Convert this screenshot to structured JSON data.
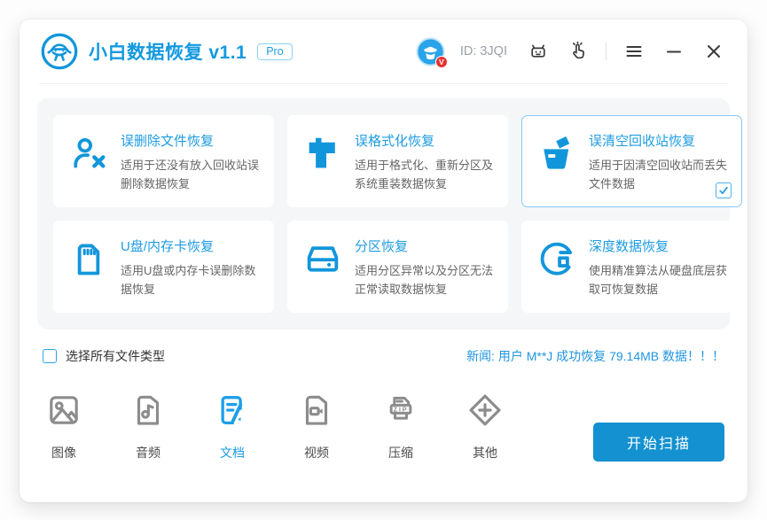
{
  "header": {
    "app_title": "小白数据恢复 v1.1",
    "pro_badge": "Pro",
    "user_id": "ID: 3JQI",
    "avatar_badge": "V"
  },
  "cards": [
    {
      "icon": "user-x-icon",
      "title": "误删除文件恢复",
      "desc": "适用于还没有放入回收站误删除数据恢复",
      "selected": false
    },
    {
      "icon": "format-brush-icon",
      "title": "误格式化恢复",
      "desc": "适用于格式化、重新分区及系统重装数据恢复",
      "selected": false
    },
    {
      "icon": "recycle-bin-icon",
      "title": "误清空回收站恢复",
      "desc": "适用于因清空回收站而丢失文件数据",
      "selected": true
    },
    {
      "icon": "sd-card-icon",
      "title": "U盘/内存卡恢复",
      "desc": "适用U盘或内存卡误删除数据恢复",
      "selected": false
    },
    {
      "icon": "hard-drive-icon",
      "title": "分区恢复",
      "desc": "适用分区异常以及分区无法正常读取数据恢复",
      "selected": false
    },
    {
      "icon": "deep-scan-icon",
      "title": "深度数据恢复",
      "desc": "使用精准算法从硬盘底层获取可恢复数据",
      "selected": false
    }
  ],
  "select_all_label": "选择所有文件类型",
  "select_all_checked": false,
  "news": "新闻: 用户 M**J 成功恢复 79.14MB 数据！！！",
  "file_types": [
    {
      "icon": "image-file-icon",
      "label": "图像",
      "active": false
    },
    {
      "icon": "audio-file-icon",
      "label": "音频",
      "active": false
    },
    {
      "icon": "document-file-icon",
      "label": "文档",
      "active": true
    },
    {
      "icon": "video-file-icon",
      "label": "视频",
      "active": false
    },
    {
      "icon": "zip-file-icon",
      "label": "压缩",
      "active": false,
      "icon_text": "ZIP"
    },
    {
      "icon": "other-file-icon",
      "label": "其他",
      "active": false
    }
  ],
  "scan_button_label": "开始扫描",
  "colors": {
    "primary": "#1296db",
    "title_blue": "#1499e0",
    "button_blue": "#1391d0",
    "news_blue": "#2196e0",
    "panel_bg": "#f5f6f8",
    "selected_border": "#85c8f1"
  }
}
